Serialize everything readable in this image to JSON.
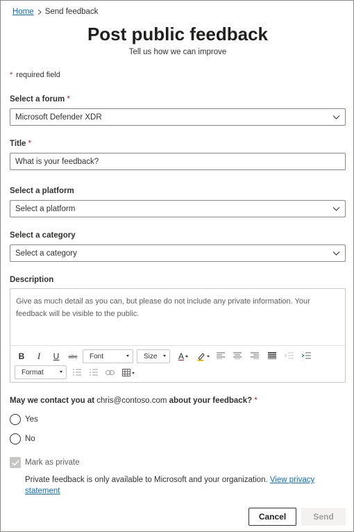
{
  "breadcrumb": {
    "home": "Home",
    "current": "Send feedback"
  },
  "header": {
    "title": "Post public feedback",
    "subtitle": "Tell us how we can improve"
  },
  "required_note": {
    "star": "*",
    "text": "required field"
  },
  "forum": {
    "label": "Select a forum",
    "star": "*",
    "value": "Microsoft Defender XDR"
  },
  "title_field": {
    "label": "Title",
    "star": "*",
    "placeholder": "What is your feedback?"
  },
  "platform": {
    "label": "Select a platform",
    "value": "Select a platform"
  },
  "category": {
    "label": "Select a category",
    "value": "Select a category"
  },
  "description": {
    "label": "Description",
    "placeholder": "Give as much detail as you can, but please do not include any private information. Your feedback will be visible to the public.",
    "toolbar": {
      "bold": "B",
      "italic": "I",
      "underline": "U",
      "strike": "abc",
      "font": "Font",
      "size": "Size",
      "font_color": "A",
      "format": "Format"
    },
    "icons": [
      "bold-icon",
      "italic-icon",
      "underline-icon",
      "strikethrough-icon",
      "font-color-icon",
      "highlight-icon",
      "align-left-icon",
      "align-center-icon",
      "align-right-icon",
      "justify-icon",
      "outdent-icon",
      "indent-icon",
      "bulleted-list-icon",
      "numbered-list-icon",
      "link-icon",
      "table-icon"
    ]
  },
  "contact": {
    "question_pre": "May we contact you at",
    "email": "chris@contoso.com",
    "question_post": "about your feedback?",
    "star": "*",
    "options": [
      "Yes",
      "No"
    ]
  },
  "private": {
    "label": "Mark as private",
    "checked": true,
    "note": "Private feedback is only available to Microsoft and your organization.",
    "link": "View privacy statement"
  },
  "buttons": {
    "cancel": "Cancel",
    "send": "Send"
  },
  "colors": {
    "link": "#0f6cbd",
    "required": "#a4262c",
    "border": "#8a8886",
    "disabled_bg": "#f3f2f1"
  }
}
